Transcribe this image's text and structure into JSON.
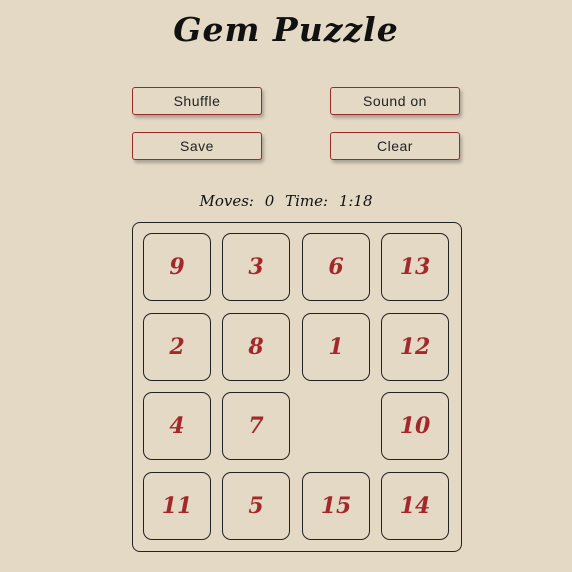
{
  "title": "Gem Puzzle",
  "buttons": {
    "shuffle": "Shuffle",
    "sound": "Sound on",
    "save": "Save",
    "clear": "Clear"
  },
  "status": {
    "moves_label": "Moves:",
    "moves": "0",
    "time_label": "Time:",
    "time": "1:18"
  },
  "board": {
    "tiles": [
      [
        "9",
        "3",
        "6",
        "13"
      ],
      [
        "2",
        "8",
        "1",
        "12"
      ],
      [
        "4",
        "7",
        "",
        "10"
      ],
      [
        "11",
        "5",
        "15",
        "14"
      ]
    ]
  },
  "colors": {
    "background": "#e4d9c5",
    "tile_text": "#a3282a",
    "button_border": "#9b2a2a"
  }
}
